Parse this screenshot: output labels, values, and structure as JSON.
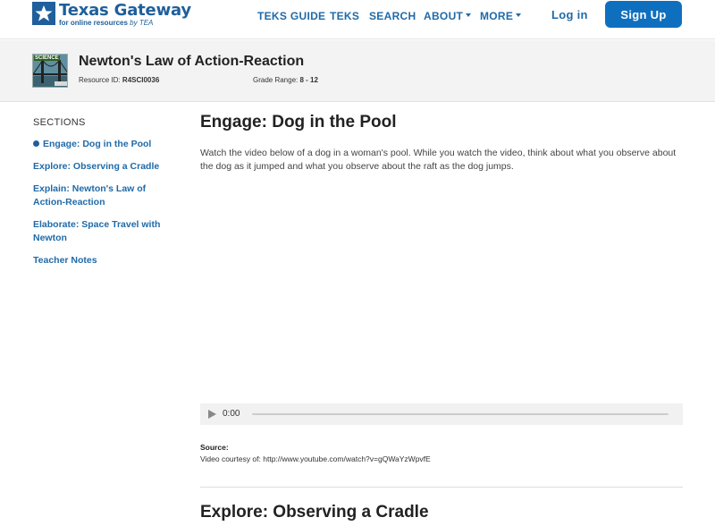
{
  "header": {
    "logo_title": "Texas Gateway",
    "logo_sub": "for online resources",
    "logo_sub_by": "by TEA",
    "nav": [
      {
        "label": "TEKS GUIDE",
        "has_caret": false
      },
      {
        "label": "TEKS",
        "has_caret": false
      },
      {
        "label": "SEARCH",
        "has_caret": false
      },
      {
        "label": "ABOUT",
        "has_caret": true
      },
      {
        "label": "MORE",
        "has_caret": true
      }
    ],
    "login_label": "Log in",
    "signup_label": "Sign Up"
  },
  "resource": {
    "thumb_label": "SCIENCE",
    "title": "Newton's Law of Action-Reaction",
    "id_label": "Resource ID:",
    "id_value": "R4SCI0036",
    "grade_label": "Grade Range:",
    "grade_value": "8 - 12"
  },
  "sidebar": {
    "heading": "SECTIONS",
    "items": [
      {
        "label": "Engage: Dog in the Pool",
        "active": true
      },
      {
        "label": "Explore: Observing a Cradle"
      },
      {
        "label": "Explain: Newton's Law of Action-Reaction"
      },
      {
        "label": "Elaborate: Space Travel with Newton"
      },
      {
        "label": "Teacher Notes"
      }
    ]
  },
  "main": {
    "heading": "Engage: Dog in the Pool",
    "paragraph": "Watch the video below of a dog in a woman's pool. While you watch the video, think about what you observe about the dog as it jumped and what you observe about the raft as the dog jumps.",
    "player_time": "0:00",
    "source_heading": "Source:",
    "source_text": "Video courtesy of: http://www.youtube.com/watch?v=gQWaYzWpvfE",
    "next_heading": "Explore: Observing a Cradle"
  },
  "colors": {
    "brand_blue": "#1f5f9b",
    "link_blue": "#1f6aa8",
    "signup_bg": "#0f6fbf"
  }
}
